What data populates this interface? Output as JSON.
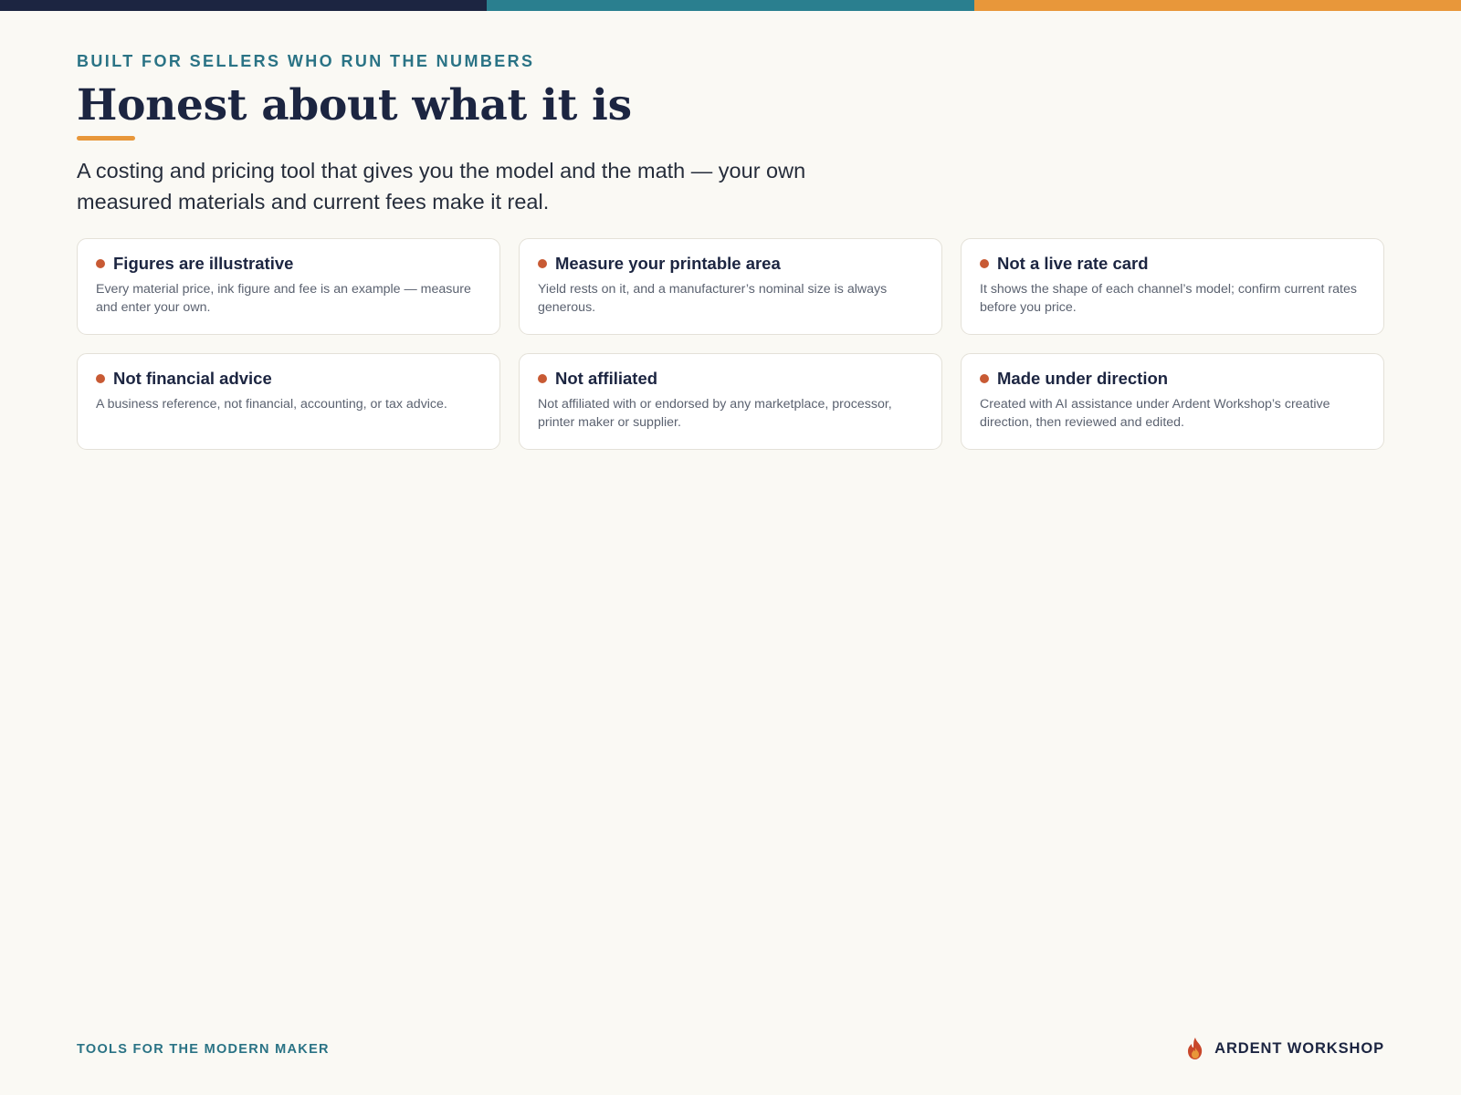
{
  "colors": {
    "navy": "#1c2541",
    "teal": "#2a7f8f",
    "orange": "#e8973a",
    "bullet": "#c85a34",
    "background": "#faf9f4"
  },
  "header": {
    "eyebrow": "BUILT FOR SELLERS WHO RUN THE NUMBERS",
    "title": "Honest about what it is",
    "lede": "A costing and pricing tool that gives you the model and the math — your own measured materials and current fees make it real."
  },
  "cards": [
    {
      "title": "Figures are illustrative",
      "body": "Every material price, ink figure and fee is an example — measure and enter your own."
    },
    {
      "title": "Measure your printable area",
      "body": "Yield rests on it, and a manufacturer’s nominal size is always generous."
    },
    {
      "title": "Not a live rate card",
      "body": "It shows the shape of each channel’s model; confirm current rates before you price."
    },
    {
      "title": "Not financial advice",
      "body": "A business reference, not financial, accounting, or tax advice."
    },
    {
      "title": "Not affiliated",
      "body": "Not affiliated with or endorsed by any marketplace, processor, printer maker or supplier."
    },
    {
      "title": "Made under direction",
      "body": "Created with AI assistance under Ardent Workshop’s creative direction, then reviewed and edited."
    }
  ],
  "footer": {
    "tagline": "TOOLS FOR THE MODERN MAKER",
    "brand": "ARDENT WORKSHOP",
    "brand_icon": "flame-icon"
  }
}
